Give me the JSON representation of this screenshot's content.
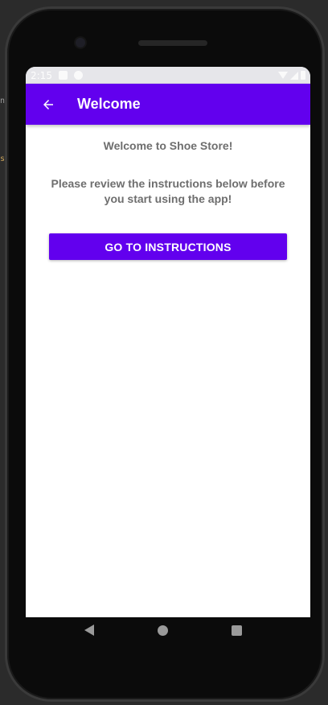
{
  "status_bar": {
    "time": "2:15"
  },
  "app_bar": {
    "title": "Welcome",
    "back_icon": "arrow-back-icon"
  },
  "content": {
    "welcome_text": "Welcome to Shoe Store!",
    "instructions_text": "Please review the instructions below before you start using the app!",
    "go_button_label": "GO TO INSTRUCTIONS"
  },
  "ide_background": {
    "line1": "ne",
    "line2": "st"
  },
  "colors": {
    "primary": "#6200ee",
    "text_secondary": "#6e6e6e"
  }
}
